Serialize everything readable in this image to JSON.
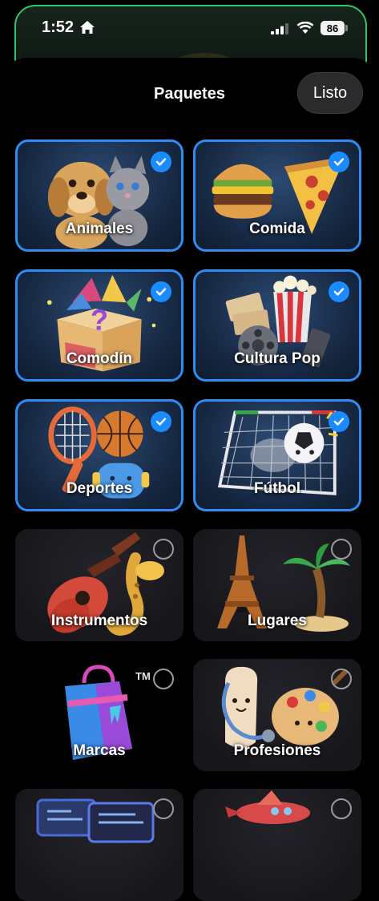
{
  "status_bar": {
    "time": "1:52",
    "battery": "86",
    "icons": [
      "home-icon",
      "signal-icon",
      "wifi-icon",
      "battery-icon"
    ]
  },
  "sheet": {
    "title": "Paquetes",
    "done_label": "Listo"
  },
  "colors": {
    "accent": "#1a8cff",
    "selected_border": "#2f8cf2"
  },
  "packs": [
    {
      "label": "Animales",
      "selected": true,
      "icon": "puppy-kitten-icon"
    },
    {
      "label": "Comida",
      "selected": true,
      "icon": "burger-pizza-icon"
    },
    {
      "label": "Comodín",
      "selected": true,
      "icon": "mystery-box-icon"
    },
    {
      "label": "Cultura Pop",
      "selected": true,
      "icon": "popcorn-film-icon"
    },
    {
      "label": "Deportes",
      "selected": true,
      "icon": "sports-balls-icon"
    },
    {
      "label": "Fútbol",
      "selected": true,
      "icon": "soccer-goal-icon"
    },
    {
      "label": "Instrumentos",
      "selected": false,
      "icon": "guitar-sax-icon"
    },
    {
      "label": "Lugares",
      "selected": false,
      "icon": "eiffel-palm-icon"
    },
    {
      "label": "Marcas",
      "selected": false,
      "icon": "shopping-bag-icon"
    },
    {
      "label": "Profesiones",
      "selected": false,
      "icon": "stethoscope-palette-icon"
    },
    {
      "label": "",
      "selected": false,
      "icon": "laptop-icon"
    },
    {
      "label": "",
      "selected": false,
      "icon": "airplane-icon"
    }
  ]
}
